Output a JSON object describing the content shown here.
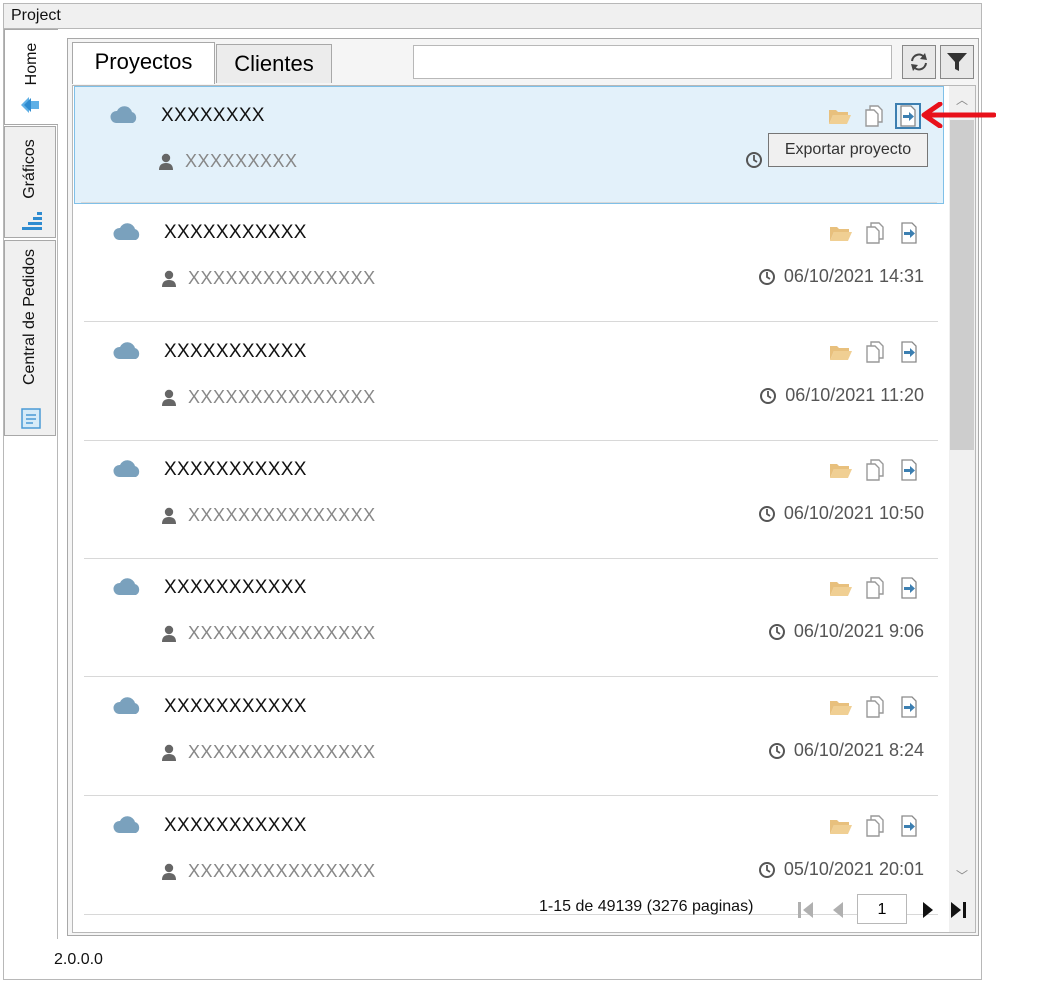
{
  "window": {
    "title": "Project",
    "version": "2.0.0.0"
  },
  "sidebar": {
    "tabs": [
      {
        "label": "Home",
        "icon": "home-icon",
        "active": true
      },
      {
        "label": "Gráficos",
        "icon": "chart-icon",
        "active": false
      },
      {
        "label": "Central de Pedidos",
        "icon": "orders-icon",
        "active": false
      }
    ]
  },
  "tabs": [
    {
      "label": "Proyectos",
      "active": true
    },
    {
      "label": "Clientes",
      "active": false
    }
  ],
  "search": {
    "value": "",
    "placeholder": ""
  },
  "toolbar": {
    "refresh_icon": "refresh-icon",
    "filter_icon": "filter-icon"
  },
  "projects": [
    {
      "name": "XXXXXXXX",
      "client": "XXXXXXXXX",
      "date": "",
      "selected": true
    },
    {
      "name": "XXXXXXXXXXX",
      "client": "XXXXXXXXXXXXXXX",
      "date": "06/10/2021 14:31",
      "selected": false
    },
    {
      "name": "XXXXXXXXXXX",
      "client": "XXXXXXXXXXXXXXX",
      "date": "06/10/2021 11:20",
      "selected": false
    },
    {
      "name": "XXXXXXXXXXX",
      "client": "XXXXXXXXXXXXXXX",
      "date": "06/10/2021 10:50",
      "selected": false
    },
    {
      "name": "XXXXXXXXXXX",
      "client": "XXXXXXXXXXXXXXX",
      "date": "06/10/2021 9:06",
      "selected": false
    },
    {
      "name": "XXXXXXXXXXX",
      "client": "XXXXXXXXXXXXXXX",
      "date": "06/10/2021 8:24",
      "selected": false
    },
    {
      "name": "XXXXXXXXXXX",
      "client": "XXXXXXXXXXXXXXX",
      "date": "05/10/2021 20:01",
      "selected": false
    }
  ],
  "tooltip": {
    "text": "Exportar proyecto"
  },
  "pagination": {
    "info": "1-15 de 49139 (3276 paginas)",
    "page": "1"
  },
  "colors": {
    "accent": "#3c7fb1",
    "selected_bg": "#e3f1fa",
    "cloud": "#7aa1bd",
    "folder": "#e8c07d",
    "annotation": "#e8101a"
  }
}
